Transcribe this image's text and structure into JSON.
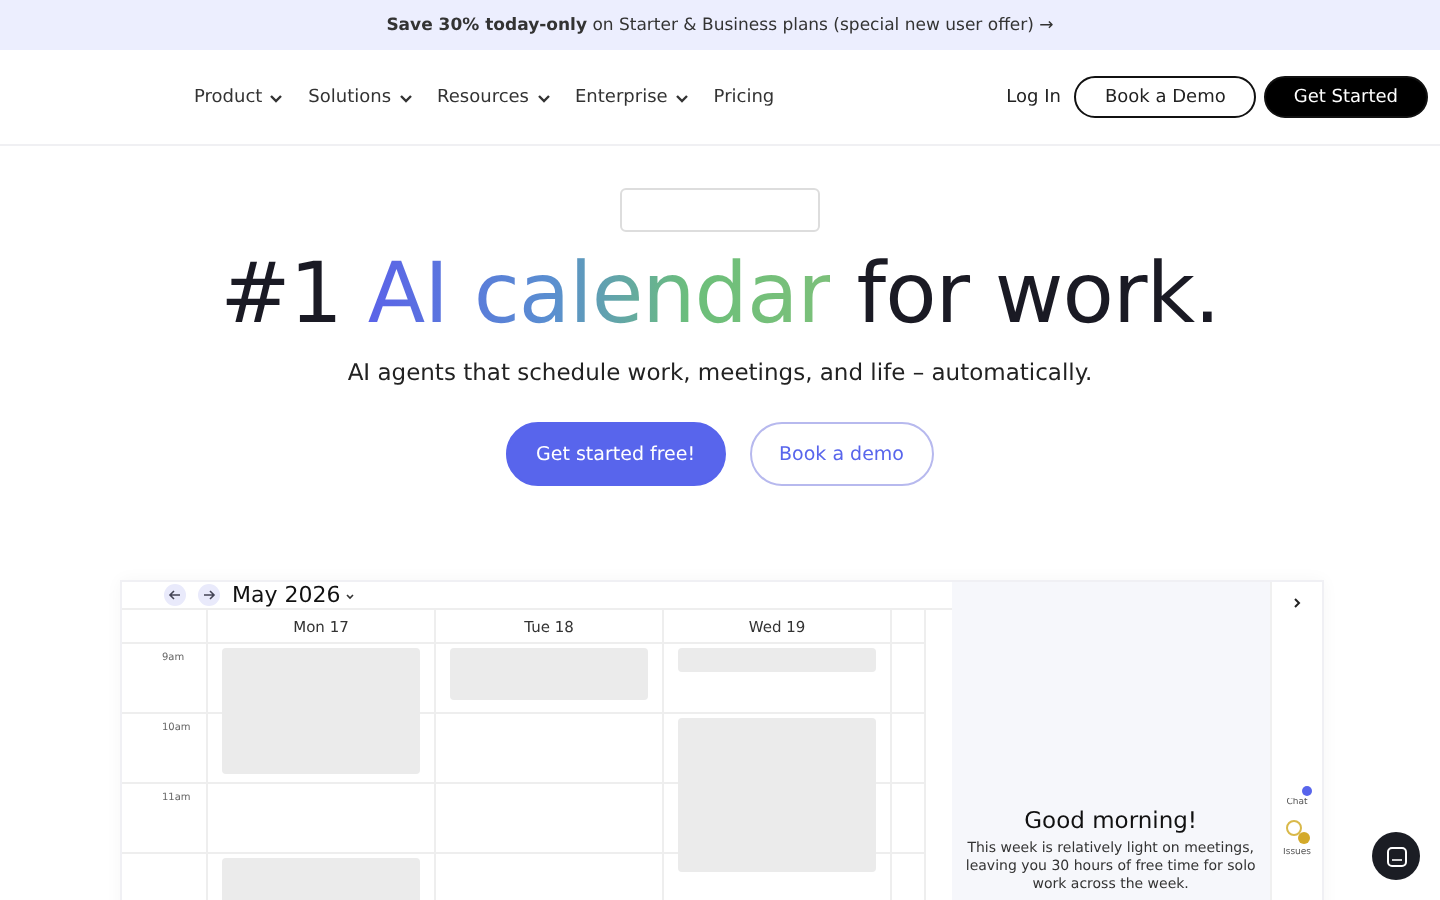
{
  "promo_bar": {
    "bold": "Save 30% today-only",
    "text": "on Starter & Business plans (special new user offer) →"
  },
  "nav": {
    "items": [
      {
        "label": "Product",
        "has_menu": true
      },
      {
        "label": "Solutions",
        "has_menu": true
      },
      {
        "label": "Resources",
        "has_menu": true
      },
      {
        "label": "Enterprise",
        "has_menu": true
      },
      {
        "label": "Pricing",
        "has_menu": false
      }
    ],
    "actions": [
      {
        "label": "Log In",
        "kind": "link"
      },
      {
        "label": "Book a Demo",
        "kind": "outline"
      },
      {
        "label": "Get Started",
        "kind": "solid"
      }
    ]
  },
  "hero": {
    "headline_start": "#1 ",
    "headline_highlight": "AI calendar",
    "headline_end": " for work.",
    "subtitle": "AI agents that schedule work, meetings, and life – automatically.",
    "buttons": [
      {
        "label": "Get started free!",
        "kind": "primary"
      },
      {
        "label": "Book a demo",
        "kind": "secondary"
      }
    ]
  },
  "calendar": {
    "month": "May 2026",
    "days": [
      "Mon 17",
      "Tue 18",
      "Wed 19"
    ],
    "times": [
      "9am",
      "10am",
      "11am"
    ]
  },
  "assistant": {
    "greeting": "Good morning!",
    "message": "This week is relatively light on meetings, leaving you 30 hours of free time for solo work across the week.",
    "rail": [
      {
        "label": "Chat",
        "kind": "chat"
      },
      {
        "label": "Issues",
        "kind": "issues"
      }
    ]
  }
}
